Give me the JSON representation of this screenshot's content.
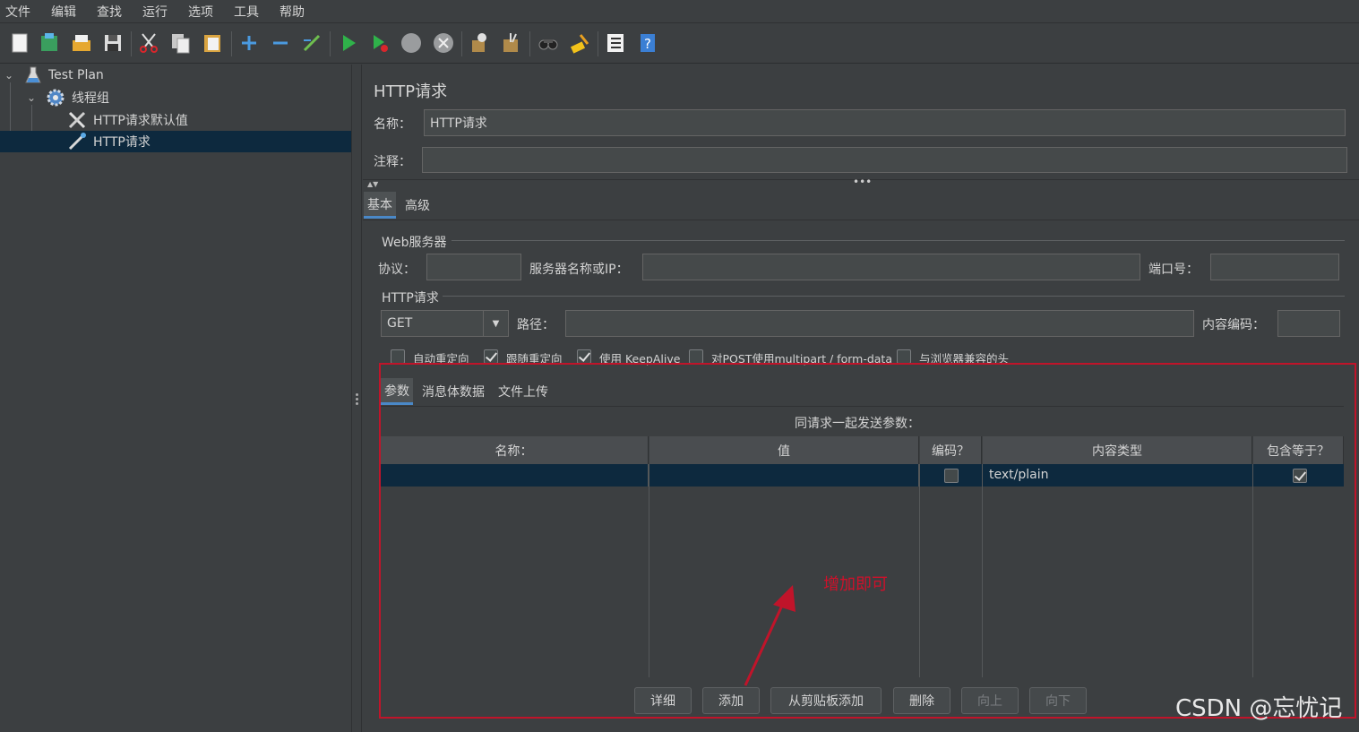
{
  "menu": [
    "文件",
    "编辑",
    "查找",
    "运行",
    "选项",
    "工具",
    "帮助"
  ],
  "toolbar_icons": [
    "new-icon",
    "templates-icon",
    "open-icon",
    "save-icon",
    "cut-icon",
    "copy-icon",
    "paste-icon",
    "expand-icon",
    "collapse-icon",
    "toggle-icon",
    "start-icon",
    "start-no-pause-icon",
    "stop-icon",
    "shutdown-icon",
    "clear-icon",
    "clear-all-icon",
    "search-icon",
    "reset-search-icon",
    "function-helper-icon",
    "help-icon"
  ],
  "tree": {
    "items": [
      {
        "label": "Test Plan",
        "icon": "flask-icon"
      },
      {
        "label": "线程组",
        "icon": "gear-icon"
      },
      {
        "label": "HTTP请求默认值",
        "icon": "wrench-icon"
      },
      {
        "label": "HTTP请求",
        "icon": "pipette-icon"
      }
    ]
  },
  "main": {
    "title": "HTTP请求",
    "name_label": "名称：",
    "name_value": "HTTP请求",
    "comment_label": "注释：",
    "comment_value": "",
    "tabs": [
      "基本",
      "高级"
    ],
    "web_server": {
      "section": "Web服务器",
      "protocol_label": "协议：",
      "protocol_value": "",
      "server_label": "服务器名称或IP：",
      "server_value": "",
      "port_label": "端口号：",
      "port_value": ""
    },
    "http_request": {
      "section": "HTTP请求",
      "method": "GET",
      "path_label": "路径：",
      "path_value": "",
      "encoding_label": "内容编码：",
      "encoding_value": ""
    },
    "options": [
      {
        "label": "自动重定向",
        "checked": false
      },
      {
        "label": "跟随重定向",
        "checked": true
      },
      {
        "label": "使用 KeepAlive",
        "checked": true
      },
      {
        "label": "对POST使用multipart / form-data",
        "checked": false
      },
      {
        "label": "与浏览器兼容的头",
        "checked": false
      }
    ],
    "sub_tabs": [
      "参数",
      "消息体数据",
      "文件上传"
    ],
    "params_caption": "同请求一起发送参数：",
    "table": {
      "headers": [
        "名称：",
        "值",
        "编码？",
        "内容类型",
        "包含等于？"
      ],
      "rows": [
        {
          "name": "",
          "value": "",
          "encode": false,
          "content_type": "text/plain",
          "include_equals": true
        }
      ]
    },
    "buttons": {
      "detail": "详细",
      "add": "添加",
      "add_clipboard": "从剪贴板添加",
      "delete": "删除",
      "up": "向上",
      "down": "向下"
    }
  },
  "annotation": "增加即可",
  "watermark": "CSDN @忘忧记",
  "colors": {
    "background": "#3c3f41",
    "selection": "#0d293e",
    "accent": "#4a88c7",
    "annotation_red": "#c0142a"
  }
}
